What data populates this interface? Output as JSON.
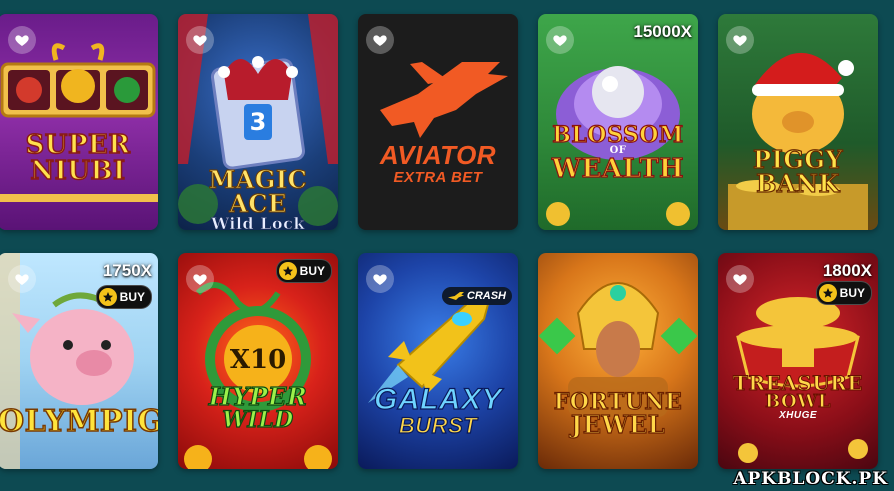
{
  "games": [
    {
      "id": "super-niubi",
      "title": "SUPER NIUBI",
      "line1": "SUPER",
      "line2": "NIUBI"
    },
    {
      "id": "magic-ace",
      "title": "MAGIC ACE Wild Lock",
      "line1": "MAGIC ACE",
      "line2": "Wild Lock",
      "card": "3"
    },
    {
      "id": "aviator",
      "title": "AVIATOR EXTRA BET",
      "line1": "AVIATOR",
      "line2": "EXTRA BET"
    },
    {
      "id": "blossom",
      "title": "BLOSSOM OF WEALTH",
      "line1": "BLOSSOM",
      "small": "OF",
      "line2": "WEALTH",
      "multiplier": "15000X"
    },
    {
      "id": "piggy",
      "title": "PIGGY BANK",
      "line1": "PIGGY BANK"
    },
    {
      "id": "olympig",
      "title": "OLYMPIG",
      "line1": "OLYMPIG",
      "multiplier": "1750X",
      "badge": "BUY"
    },
    {
      "id": "hyper-wild",
      "title": "X10 HYPER WILD",
      "x10": "X10",
      "line1": "HYPER",
      "line2": "WILD",
      "badge": "BUY"
    },
    {
      "id": "galaxy",
      "title": "GALAXY BURST",
      "line1": "GALAXY",
      "line2": "BURST",
      "crash": "CRASH"
    },
    {
      "id": "fortune",
      "title": "FORTUNE JEWEL",
      "line1": "FORTUNE",
      "line2": "JEWEL"
    },
    {
      "id": "treasure",
      "title": "TREASURE BOWL X HUGE",
      "line1": "TREASURE",
      "line2": "BOWL",
      "small": "XHUGE",
      "multiplier": "1800X",
      "badge": "BUY"
    }
  ],
  "watermark": "APKBLOCK.PK",
  "colors": {
    "background": "#0d4a52",
    "favorite": "#ffffff",
    "buy_star": "#f4c21a"
  }
}
